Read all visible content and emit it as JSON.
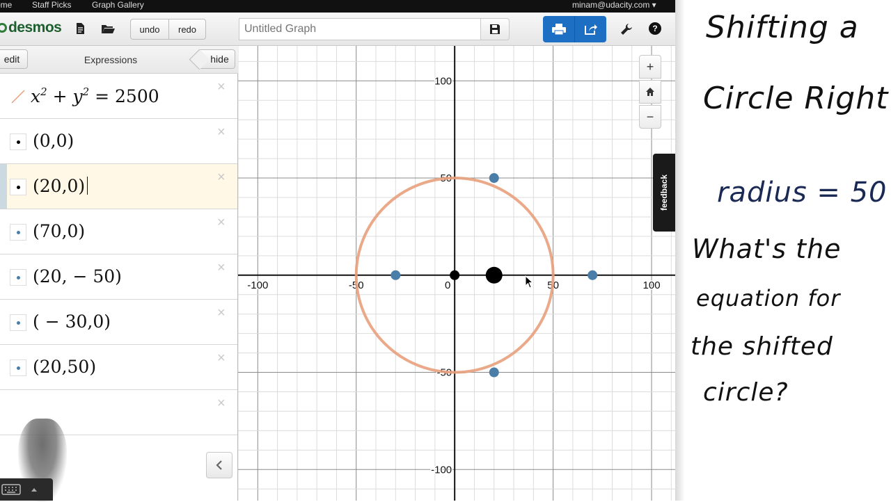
{
  "topnav": {
    "home": "ome",
    "staff_picks": "Staff Picks",
    "graph_gallery": "Graph Gallery",
    "user": "minam@udacity.com"
  },
  "toolbar": {
    "logo": "desmos",
    "undo": "undo",
    "redo": "redo",
    "graph_title_placeholder": "Untitled Graph"
  },
  "expressions": {
    "edit": "edit",
    "title": "Expressions",
    "hide": "hide",
    "close_glyph": "×",
    "rows": [
      {
        "kind": "curve",
        "text": "",
        "active": false,
        "color": "#e8a07c"
      },
      {
        "kind": "point",
        "text": "(0,0)",
        "active": false,
        "color": "#000000"
      },
      {
        "kind": "point",
        "text": "(20,0)",
        "active": true,
        "color": "#000000"
      },
      {
        "kind": "point",
        "text": "(70,0)",
        "active": false,
        "color": "#4a7ea8"
      },
      {
        "kind": "point",
        "text": "(20, − 50)",
        "active": false,
        "color": "#4a7ea8"
      },
      {
        "kind": "point",
        "text": "( − 30,0)",
        "active": false,
        "color": "#4a7ea8"
      },
      {
        "kind": "point",
        "text": "(20,50)",
        "active": false,
        "color": "#4a7ea8"
      },
      {
        "kind": "empty",
        "text": "",
        "active": false,
        "color": ""
      }
    ],
    "equation": {
      "x": "x",
      "sup1": "2",
      "plus": " + ",
      "y": "y",
      "sup2": "2",
      "rhs": " = 2500"
    }
  },
  "graph": {
    "x_range": [
      -110,
      112
    ],
    "y_range": [
      -116,
      118
    ],
    "grid_minor": 10,
    "grid_major": 50,
    "x_tick_labels": [
      "-100",
      "-50",
      "0",
      "50",
      "100"
    ],
    "y_tick_labels": [
      "100",
      "50",
      "-50",
      "-100"
    ],
    "circle": {
      "cx": 0,
      "cy": 0,
      "r": 50,
      "color": "#e8a07c"
    },
    "points": [
      {
        "x": 0,
        "y": 0,
        "color": "#000000",
        "size": "normal"
      },
      {
        "x": 20,
        "y": 0,
        "color": "#000000",
        "size": "large"
      },
      {
        "x": 70,
        "y": 0,
        "color": "#4a7ea8",
        "size": "normal"
      },
      {
        "x": 20,
        "y": -50,
        "color": "#4a7ea8",
        "size": "normal"
      },
      {
        "x": -30,
        "y": 0,
        "color": "#4a7ea8",
        "size": "normal"
      },
      {
        "x": 20,
        "y": 50,
        "color": "#4a7ea8",
        "size": "normal"
      }
    ],
    "zoom_in": "+",
    "zoom_out": "−",
    "feedback": "feedback"
  },
  "whiteboard": {
    "title_line1": "Shifting a",
    "title_line2": "Circle Right",
    "radius": "radius = 50",
    "question_line1": "What's the",
    "question_line2": "equation for",
    "question_line3": "the shifted",
    "question_line4": "circle?"
  }
}
